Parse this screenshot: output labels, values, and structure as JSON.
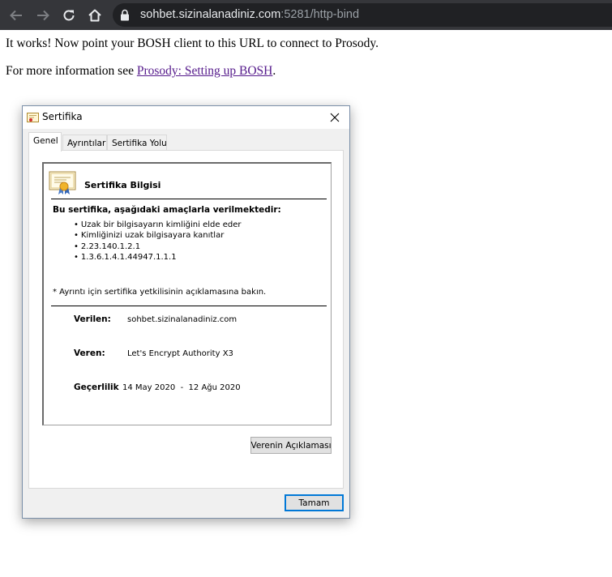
{
  "browser": {
    "url_host": "sohbet.sizinalanadiniz.com",
    "url_rest": ":5281/http-bind",
    "icons": {
      "back": "arrow-left-icon",
      "forward": "arrow-right-icon",
      "reload": "reload-icon",
      "home": "home-icon",
      "security": "lock-icon"
    }
  },
  "page": {
    "line1": "It works! Now point your BOSH client to this URL to connect to Prosody.",
    "line2_prefix": "For more information see ",
    "line2_link": "Prosody: Setting up BOSH",
    "line2_suffix": "."
  },
  "dialog": {
    "title": "Sertifika",
    "tabs": [
      {
        "label": "Genel",
        "active": true
      },
      {
        "label": "Ayrıntılar",
        "active": false
      },
      {
        "label": "Sertifika Yolu",
        "active": false
      }
    ],
    "cert_heading": "Sertifika Bilgisi",
    "purpose_title": "Bu sertifika, aşağıdaki amaçlarla verilmektedir:",
    "purposes": [
      "Uzak bir bilgisayarın kimliğini elde eder",
      "Kimliğinizi uzak bilgisayara kanıtlar",
      "2.23.140.1.2.1",
      "1.3.6.1.4.1.44947.1.1.1"
    ],
    "note": "* Ayrıntı için sertifika yetkilisinin açıklamasına bakın.",
    "issued_to_label": "Verilen:",
    "issued_to_value": "sohbet.sizinalanadiniz.com",
    "issued_by_label": "Veren:",
    "issued_by_value": "Let's Encrypt Authority X3",
    "validity_label": "Geçerlilik",
    "valid_from": "14 May 2020",
    "valid_sep": "-",
    "valid_to": "12 Ağu 2020",
    "issuer_statement_button": "Verenin Açıklaması",
    "ok_button": "Tamam"
  },
  "colors": {
    "toolbar": "#35363a",
    "omnibox": "#202124",
    "link_visited": "#551a8b",
    "focus_blue": "#0078d7"
  }
}
